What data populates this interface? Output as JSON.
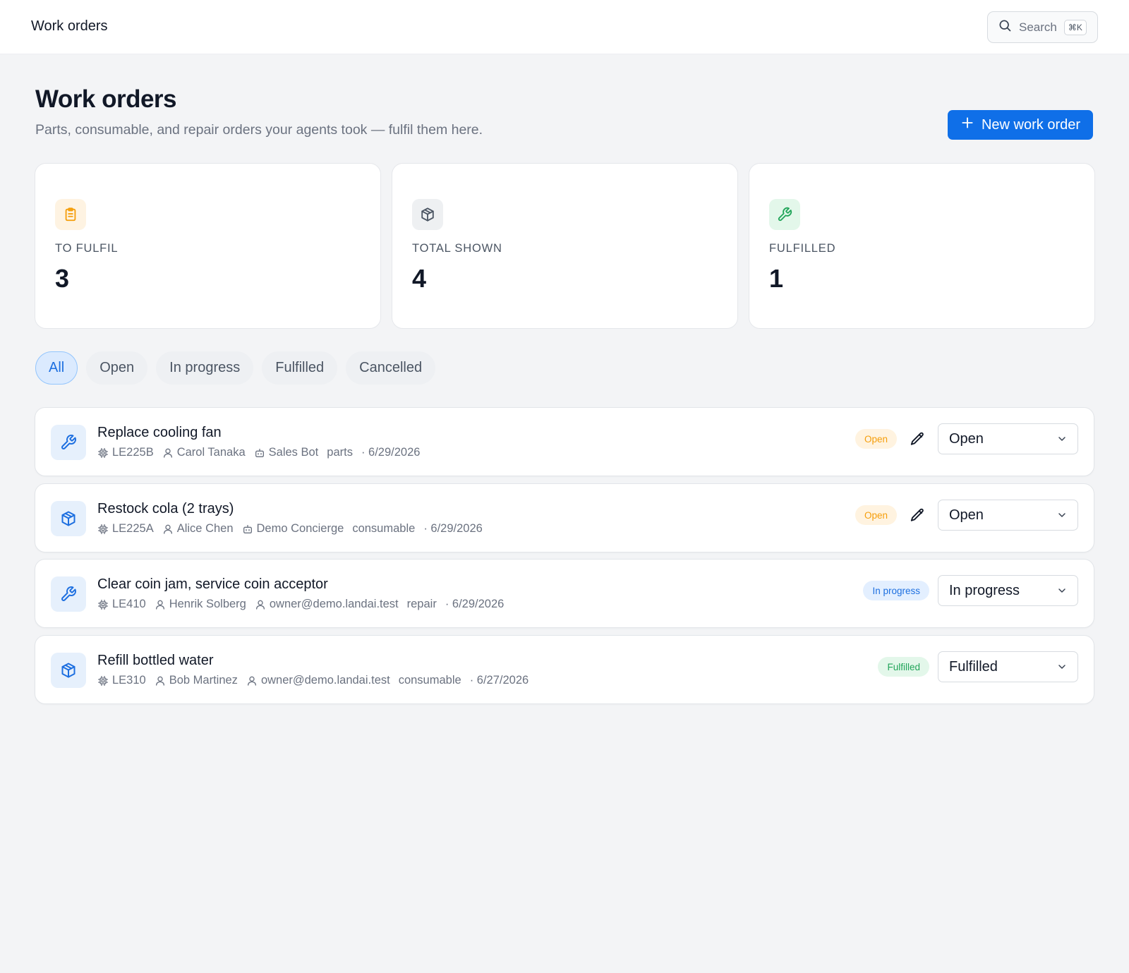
{
  "header": {
    "title": "Work orders",
    "search_label": "Search",
    "search_shortcut": "⌘K"
  },
  "page": {
    "title": "Work orders",
    "subtitle": "Parts, consumable, and repair orders your agents took — fulfil them here.",
    "new_button_label": "New work order"
  },
  "stats": [
    {
      "label": "TO FULFIL",
      "value": "3",
      "icon": "clipboard-icon",
      "color": "#f59e0b",
      "bg": "#fef3e2"
    },
    {
      "label": "TOTAL SHOWN",
      "value": "4",
      "icon": "box-icon",
      "color": "#4b5563",
      "bg": "#eef0f2"
    },
    {
      "label": "FULFILLED",
      "value": "1",
      "icon": "wrench-icon",
      "color": "#22a55a",
      "bg": "#e3f7ea"
    }
  ],
  "filters": [
    "All",
    "Open",
    "In progress",
    "Fulfilled",
    "Cancelled"
  ],
  "active_filter": "All",
  "orders": [
    {
      "title": "Replace cooling fan",
      "icon": "wrench-icon",
      "machine": "LE225B",
      "assignee": "Carol Tanaka",
      "agent": "Sales Bot",
      "agent_icon": "bot-icon",
      "type": "parts",
      "date": "· 6/29/2026",
      "badge": "Open",
      "editable": true,
      "status": "Open"
    },
    {
      "title": "Restock cola (2 trays)",
      "icon": "box-icon",
      "machine": "LE225A",
      "assignee": "Alice Chen",
      "agent": "Demo Concierge",
      "agent_icon": "bot-icon",
      "type": "consumable",
      "date": "· 6/29/2026",
      "badge": "Open",
      "editable": true,
      "status": "Open"
    },
    {
      "title": "Clear coin jam, service coin acceptor",
      "icon": "wrench-icon",
      "machine": "LE410",
      "assignee": "Henrik Solberg",
      "agent": "owner@demo.landai.test",
      "agent_icon": "user-icon",
      "type": "repair",
      "date": "· 6/29/2026",
      "badge": "In progress",
      "editable": false,
      "status": "In progress"
    },
    {
      "title": "Refill bottled water",
      "icon": "box-icon",
      "machine": "LE310",
      "assignee": "Bob Martinez",
      "agent": "owner@demo.landai.test",
      "agent_icon": "user-icon",
      "type": "consumable",
      "date": "· 6/27/2026",
      "badge": "Fulfilled",
      "editable": false,
      "status": "Fulfilled"
    }
  ],
  "badge_colors": {
    "Open": {
      "bg": "#fff3e0",
      "fg": "#f59e0b"
    },
    "In progress": {
      "bg": "#e3efff",
      "fg": "#1d6fe0"
    },
    "Fulfilled": {
      "bg": "#e3f7ea",
      "fg": "#22a55a"
    }
  },
  "colors": {
    "accent": "#0f6fe8",
    "order_icon": "#1d6fe0"
  }
}
